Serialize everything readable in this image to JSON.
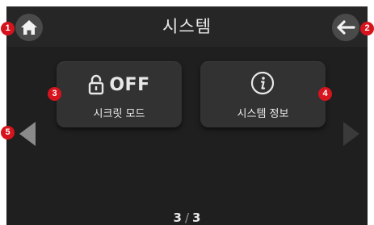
{
  "header": {
    "title": "시스템",
    "home_icon": "home-icon",
    "back_icon": "back-arrow-icon"
  },
  "tiles": [
    {
      "status": "OFF",
      "label": "시크릿 모드",
      "icon": "lock-open-icon"
    },
    {
      "label": "시스템 정보",
      "icon": "info-icon"
    }
  ],
  "pagination": {
    "current": "3",
    "separator": "/",
    "total": "3"
  },
  "nav": {
    "prev_icon": "prev-page-arrow-icon",
    "next_icon": "next-page-arrow-icon"
  },
  "annotations": [
    "1",
    "2",
    "3",
    "4",
    "5"
  ],
  "colors": {
    "background": "#1f1f1f",
    "header": "#262626",
    "tile": "#323232",
    "badge": "#d7141d",
    "text": "#e8e8e8"
  }
}
